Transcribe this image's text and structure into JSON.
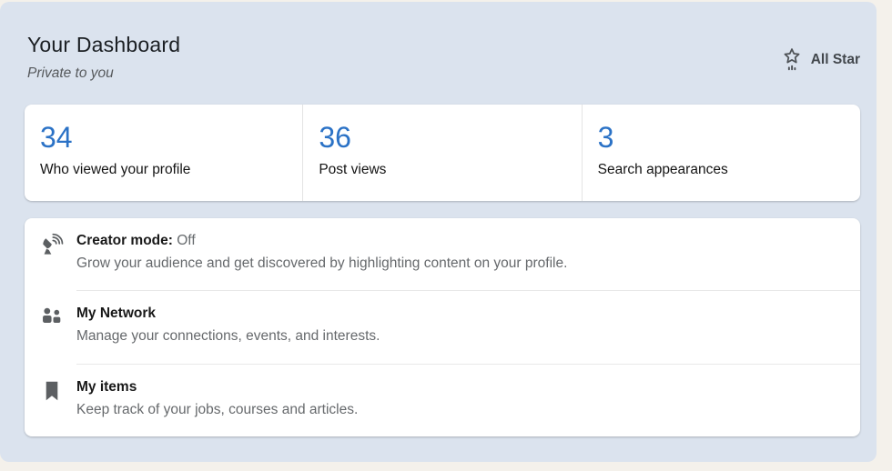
{
  "header": {
    "title": "Your Dashboard",
    "subtitle": "Private to you",
    "badge_label": "All Star",
    "badge_icon": "star-meter-icon"
  },
  "stats": [
    {
      "value": "34",
      "label": "Who viewed your profile"
    },
    {
      "value": "36",
      "label": "Post views"
    },
    {
      "value": "3",
      "label": "Search appearances"
    }
  ],
  "menu": [
    {
      "icon": "satellite-dish-icon",
      "title": "Creator mode:",
      "status": "Off",
      "description": "Grow your audience and get discovered by highlighting content on your profile."
    },
    {
      "icon": "people-icon",
      "title": "My Network",
      "description": "Manage your connections, events, and interests."
    },
    {
      "icon": "bookmark-icon",
      "title": "My items",
      "description": "Keep track of your jobs, courses and articles."
    }
  ],
  "colors": {
    "accent_blue": "#2b72c6",
    "panel_background": "#dbe3ee",
    "page_background": "#f4f1eb",
    "card_background": "#ffffff",
    "icon_gray": "#5c5f62",
    "title_text": "#1b1f23",
    "muted_text": "#66696c"
  }
}
